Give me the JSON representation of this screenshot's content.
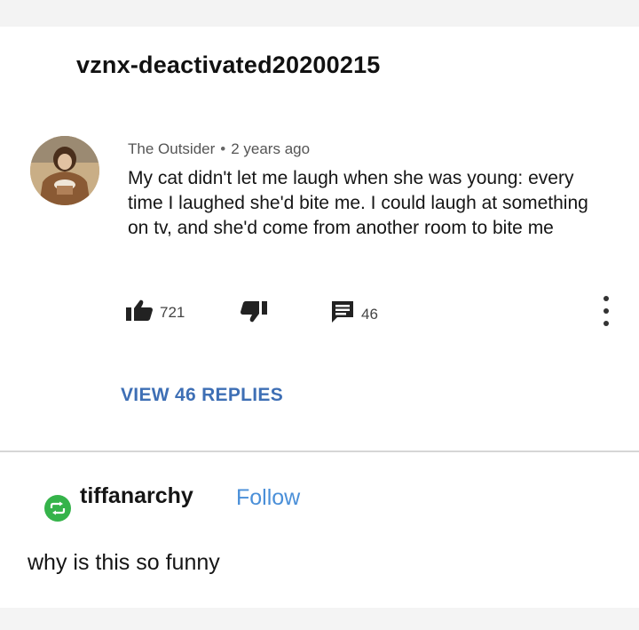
{
  "post": {
    "username": "vznx-deactivated20200215"
  },
  "comment": {
    "author": "The Outsider",
    "separator": "•",
    "time": "2 years ago",
    "text": "My cat didn't let me laugh when she was young: every time I laughed she'd bite me. I could laugh at something on tv, and she'd come from another room to bite me",
    "like_count": "721",
    "reply_count": "46",
    "view_replies_label": "VIEW 46 REPLIES",
    "icons": {
      "like": "thumbs-up-icon",
      "dislike": "thumbs-down-icon",
      "reply": "comment-icon",
      "more": "more-vertical-icon"
    }
  },
  "reblog": {
    "icon": "reblog-icon",
    "icon_color": "#35b34a",
    "username": "tiffanarchy",
    "follow_label": "Follow",
    "follow_color": "#4a8fd8",
    "text": "why is this so funny"
  },
  "colors": {
    "link_blue": "#3e6fb5"
  }
}
